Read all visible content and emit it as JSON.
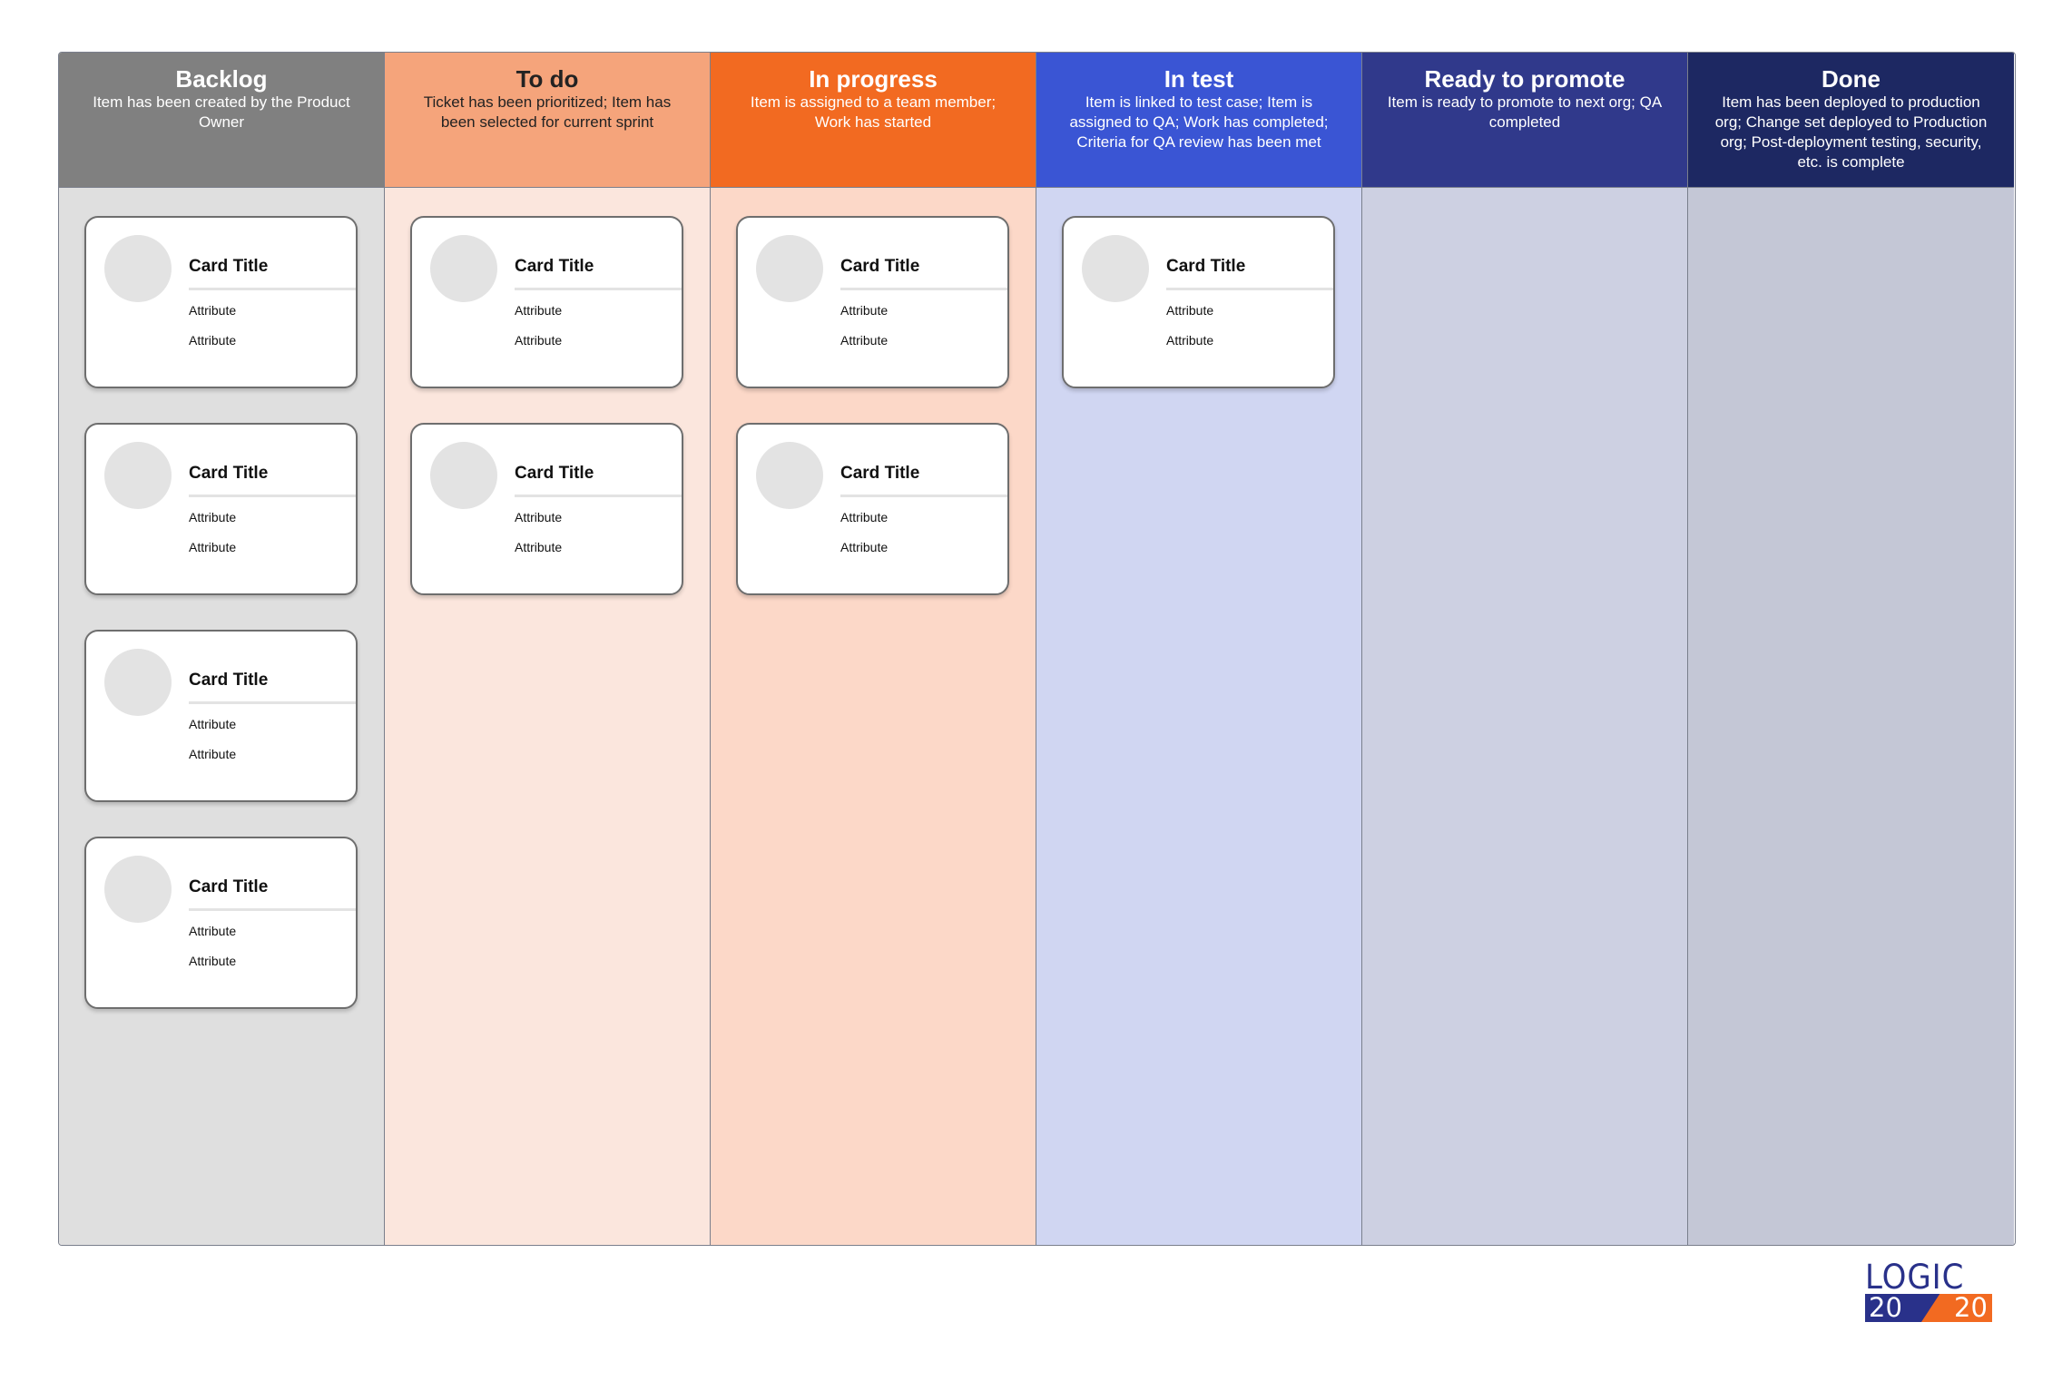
{
  "columns": [
    {
      "title": "Backlog",
      "description": "Item has been created by the Product Owner",
      "header_color": "#808080",
      "body_color": "#dfdfdf",
      "text_color": "#ffffff",
      "cards": [
        {
          "title": "Card Title",
          "attributes": [
            "Attribute",
            "Attribute"
          ]
        },
        {
          "title": "Card Title",
          "attributes": [
            "Attribute",
            "Attribute"
          ]
        },
        {
          "title": "Card Title",
          "attributes": [
            "Attribute",
            "Attribute"
          ]
        },
        {
          "title": "Card Title",
          "attributes": [
            "Attribute",
            "Attribute"
          ]
        }
      ]
    },
    {
      "title": "To do",
      "description": "Ticket has been prioritized; Item has been selected for current sprint",
      "header_color": "#f5a47b",
      "body_color": "#fbe6dd",
      "text_color": "#222222",
      "cards": [
        {
          "title": "Card Title",
          "attributes": [
            "Attribute",
            "Attribute"
          ]
        },
        {
          "title": "Card Title",
          "attributes": [
            "Attribute",
            "Attribute"
          ]
        }
      ]
    },
    {
      "title": "In progress",
      "description": "Item is assigned to a team member; Work has started",
      "header_color": "#f26a21",
      "body_color": "#fcd8c8",
      "text_color": "#ffffff",
      "cards": [
        {
          "title": "Card Title",
          "attributes": [
            "Attribute",
            "Attribute"
          ]
        },
        {
          "title": "Card Title",
          "attributes": [
            "Attribute",
            "Attribute"
          ]
        }
      ]
    },
    {
      "title": "In test",
      "description": "Item is linked to test case; Item is assigned to QA; Work has completed; Criteria for QA review has been met",
      "header_color": "#3a55d4",
      "body_color": "#d0d6f2",
      "text_color": "#ffffff",
      "cards": [
        {
          "title": "Card Title",
          "attributes": [
            "Attribute",
            "Attribute"
          ]
        }
      ]
    },
    {
      "title": "Ready to promote",
      "description": "Item is ready to promote to next org; QA completed",
      "header_color": "#30398b",
      "body_color": "#cdd0e2",
      "text_color": "#ffffff",
      "cards": []
    },
    {
      "title": "Done",
      "description": "Item has been deployed to production org; Change set deployed to Production org; Post-deployment testing, security, etc. is complete",
      "header_color": "#1d2862",
      "body_color": "#c4c7d6",
      "text_color": "#ffffff",
      "cards": []
    }
  ],
  "logo": {
    "top": "LOGIC",
    "left": "20",
    "right": "20",
    "brand_blue": "#29318a",
    "brand_orange": "#f26a21"
  }
}
